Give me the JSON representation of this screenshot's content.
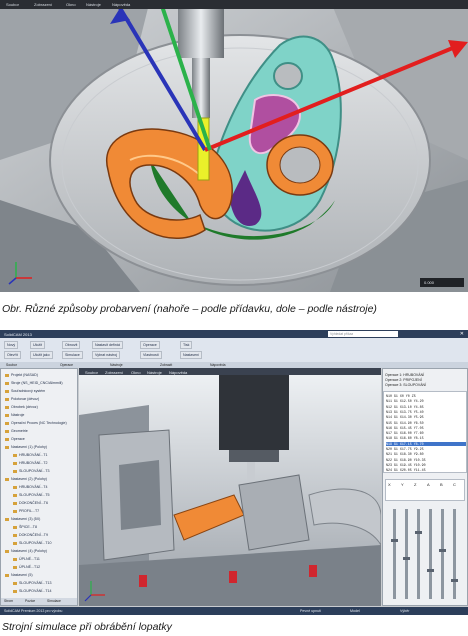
{
  "figure1": {
    "title": "Obr. Různé způsoby probarvení (nahoře – podle přídavku, dole – podle nástroje)",
    "menu": [
      "Soubor",
      "Zobrazení",
      "Okno",
      "Nástroje",
      "Nápověda"
    ],
    "hud_label": "0.000"
  },
  "figure2": {
    "title": "Strojní simulace při obrábění lopatky",
    "app_title": "SolidCAM 2013",
    "search_placeholder": "Vyhledat příkaz",
    "ribbon_buttons": [
      "Nový",
      "Otevřít",
      "Uložit",
      "Uložit jako",
      "Obnovit",
      "Simulace",
      "Nastavit definici",
      "Vybrat nástroj",
      "Operace",
      "Vlastnosti",
      "Tisk",
      "Nastavení"
    ],
    "ribbon_groups": [
      "Soubor",
      "Operace",
      "Nástroje",
      "Zobrazit",
      "Nápověda"
    ],
    "tree": [
      "Projekt (NASAD)",
      "Stroje (NS_HEID_CNC/Alimmill)",
      "Souřadnicový systém",
      "Polotovar (dévoz)",
      "Obrobek (dévoz)",
      "Nástroje",
      "Operační Proces (NC Technologie)",
      "Geometrie",
      "Operace",
      "Nastavení (1) (Polohy)",
      "HRUBOVÁNÍ...T1",
      "HRUBOVÁNÍ...T2",
      "SLOUPOVÁNÍ...T3",
      "Nastavení (2) (Polohy)",
      "HRUBOVÁNÍ...T4",
      "SLOUPOVÁNÍ...T5",
      "DOKONČENÍ...T6",
      "PROFIL...T7",
      "Nastavení (3) (5X)",
      "ŠPICE...T8",
      "DOKONČENÍ...T9",
      "SLOUPOVÁNÍ...T10",
      "Nastavení (4) (Polohy)",
      "ÚPLNÉ...T11",
      "ÚPLNÉ...T12",
      "Nastavení (5)",
      "SLOUPOVÁNÍ...T13",
      "SLOUPOVÁNÍ...T14"
    ],
    "view_menu": [
      "Soubor",
      "Zobrazení",
      "Okno",
      "Nástroje",
      "Nápověda"
    ],
    "ops_list": [
      "Operace 1: HRUBOVÁNÍ",
      "Operace 2: PRIPOJENÍ",
      "Operace 3: SLOUPOVÁNÍ"
    ],
    "nc_lines": [
      "N10 G1 X0 Y0 Z5",
      "N11 G1 X12.50 Y4.20",
      "N12 G1 X13.10 Y4.85",
      "N13 G1 X13.75 Y5.40",
      "N14 G1 X14.30 Y5.95",
      "N15 G1 X14.90 Y6.50",
      "N16 G1 X15.45 Y7.05",
      "N17 G1 X16.00 Y7.60",
      "N18 G1 X16.60 Y8.15",
      "N19 G1 X17.15 Y8.70",
      "N20 G1 X17.75 Y9.25",
      "N21 G1 X18.30 Y9.80",
      "N22 G1 X18.90 Y10.35",
      "N23 G1 X19.45 Y10.90",
      "N24 G1 X20.05 Y11.45"
    ],
    "tabs": [
      "Strom",
      "Pozice",
      "Simulace"
    ],
    "statusbar": [
      "SolidCAM Premium 2013 pro výrobu",
      "Pevné upnutí",
      "Model",
      "Výběr"
    ],
    "axis_labels": [
      "X",
      "Y",
      "Z",
      "A",
      "B",
      "C"
    ]
  }
}
